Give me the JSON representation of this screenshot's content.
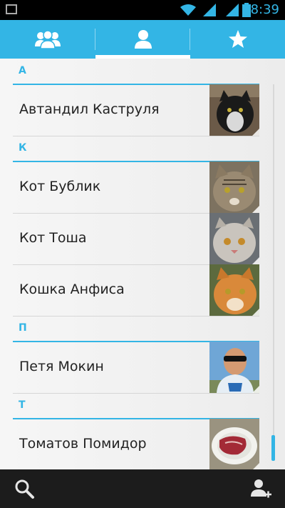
{
  "status_bar": {
    "time": "8:39"
  },
  "tabs": [
    {
      "icon": "groups-icon"
    },
    {
      "icon": "person-icon",
      "selected": true
    },
    {
      "icon": "star-icon"
    }
  ],
  "sections": [
    {
      "letter": "А",
      "contacts": [
        {
          "name": "Автандил Каструля",
          "photo": "black-white-cat"
        }
      ]
    },
    {
      "letter": "К",
      "contacts": [
        {
          "name": "Кот Бублик",
          "photo": "tabby-cat"
        },
        {
          "name": "Кот Тоша",
          "photo": "grey-persian-cat"
        },
        {
          "name": "Кошка Анфиса",
          "photo": "orange-cat"
        }
      ]
    },
    {
      "letter": "П",
      "contacts": [
        {
          "name": "Петя Мокин",
          "photo": "man-sunglasses"
        }
      ]
    },
    {
      "letter": "Т",
      "contacts": [
        {
          "name": "Томатов Помидор",
          "photo": "meat-plate"
        }
      ]
    }
  ],
  "bottom_bar": {
    "search_icon": "search-icon",
    "add_icon": "add-contact-icon"
  },
  "colors": {
    "accent": "#33b5e5",
    "background": "#f2f2f2",
    "bottom_bar": "#1c1c1c"
  }
}
